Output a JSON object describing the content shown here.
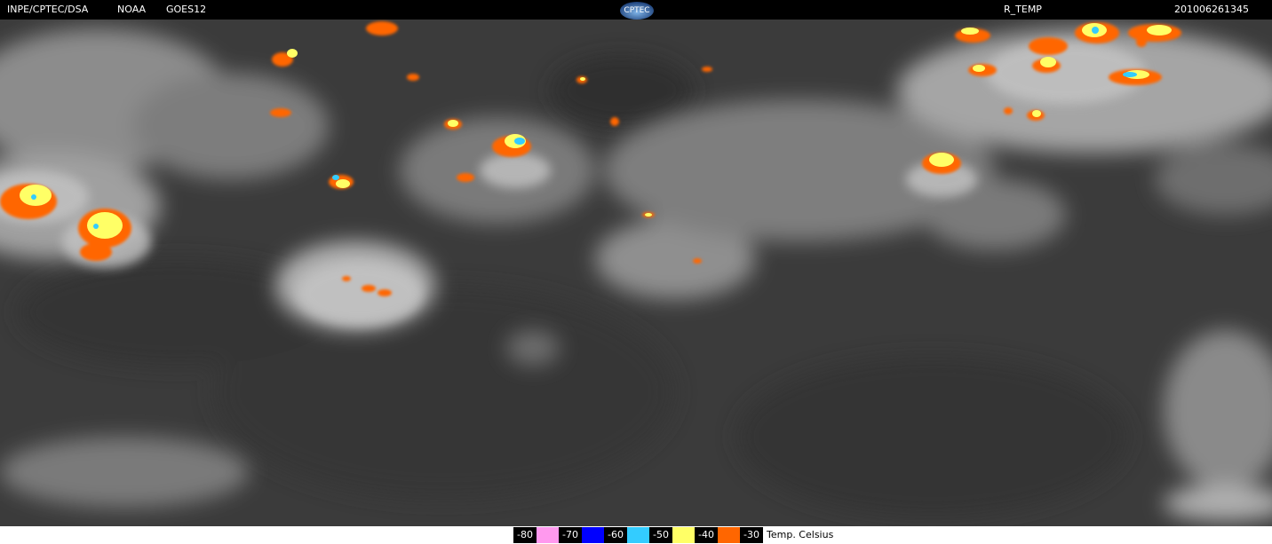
{
  "header": {
    "source": "INPE/CPTEC/DSA",
    "agency": "NOAA",
    "satellite": "GOES12",
    "logo_text": "CPTEC",
    "product": "R_TEMP",
    "timestamp": "201006261345"
  },
  "legend": {
    "items": [
      {
        "label": "-80",
        "color": "#ff99ee"
      },
      {
        "label": "-70",
        "color": "#0000ff"
      },
      {
        "label": "-60",
        "color": "#33ccff"
      },
      {
        "label": "-50",
        "color": "#ffff66"
      },
      {
        "label": "-40",
        "color": "#ff6600"
      },
      {
        "label": "-30",
        "color": null
      }
    ],
    "units": "Temp. Celsius"
  },
  "colors": {
    "background_land": "#3a3a3a",
    "cloud": "#b5b5b5",
    "cold_orange": "#ff6600",
    "cold_yellow": "#ffff66",
    "cold_cyan": "#33ccff"
  }
}
